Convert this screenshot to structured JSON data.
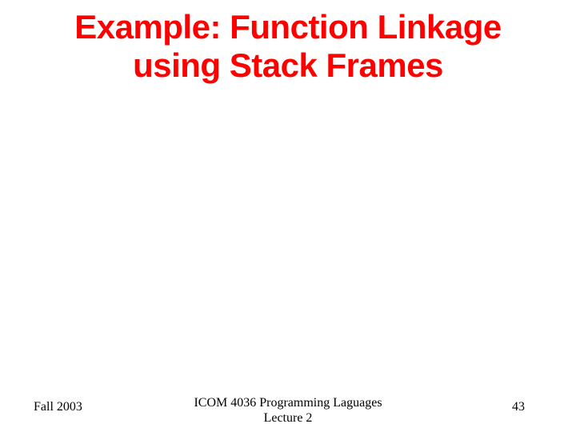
{
  "title": {
    "line1": "Example: Function Linkage",
    "line2": "using Stack Frames"
  },
  "footer": {
    "left": "Fall 2003",
    "center_line1": "ICOM 4036 Programming Laguages",
    "center_line2": "Lecture 2",
    "right": "43"
  }
}
